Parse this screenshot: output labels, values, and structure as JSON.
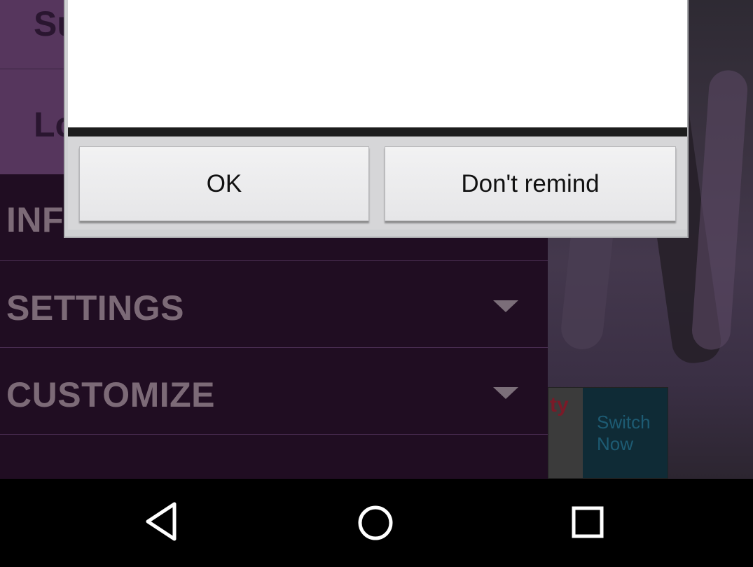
{
  "drawer": {
    "top_items": [
      {
        "label": "Su"
      },
      {
        "label": "Lo"
      }
    ],
    "menu_items": [
      {
        "label": "INF"
      },
      {
        "label": "SETTINGS"
      },
      {
        "label": "CUSTOMIZE"
      }
    ]
  },
  "dialog": {
    "ok_label": "OK",
    "dont_remind_label": "Don't remind"
  },
  "ad": {
    "left_text": "ty",
    "right_text": "Switch Now"
  },
  "navbar": {
    "icons": [
      "back-icon",
      "home-icon",
      "recents-icon"
    ]
  },
  "colors": {
    "drawer_bg": "#200d22",
    "drawer_top_bg": "#56365d",
    "menu_text": "#7c6a77",
    "dialog_bg": "#cfd0d2"
  }
}
